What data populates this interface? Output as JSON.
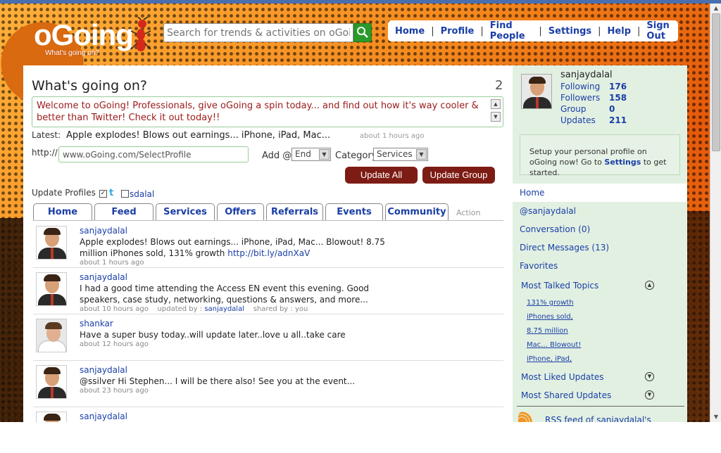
{
  "header": {
    "logo_main": "oGoing",
    "logo_tagline": "What's going on?",
    "search_placeholder": "Search for trends & activities on oGoing",
    "nav": [
      "Home",
      "Profile",
      "Find People",
      "Settings",
      "Help",
      "Sign Out"
    ]
  },
  "composer": {
    "title": "What's going on?",
    "count": "2",
    "status_text": "Welcome to oGoing! Professionals, give oGoing a spin today... and find out how it's way cooler & better than Twitter! Check it out today!!",
    "latest_label": "Latest:",
    "latest_text": "Apple explodes! Blows out earnings... iPhone, iPad, Mac...",
    "latest_ago": "about 1 hours ago",
    "http_label": "http://",
    "url_value": "www.oGoing.com/SelectProfile",
    "add_label": "Add @",
    "add_value": "End",
    "category_label": "Category",
    "category_value": "Services",
    "update_all": "Update All",
    "update_group": "Update Group",
    "update_profiles_label": "Update Profiles",
    "profile_name": "sdalal"
  },
  "tabs": [
    "Home",
    "Feed",
    "Services",
    "Offers",
    "Referrals",
    "Events",
    "Community"
  ],
  "tabs_action": "Action",
  "feed": [
    {
      "user": "sanjaydalal",
      "text": "Apple explodes! Blows out earnings... iPhone, iPad, Mac... Blowout! 8.75 million iPhones sold, 131% growth ",
      "link": "http://bit.ly/adnXaV",
      "ago": "about 1 hours ago"
    },
    {
      "user": "sanjaydalal",
      "text": "I had a good time attending the Access EN event this evening. Good speakers, case study, networking, questions & answers, and more...",
      "ago": "about 10 hours ago",
      "updated_label": "updated by :",
      "updated_by": "sanjaydalal",
      "shared_label": "shared by : you"
    },
    {
      "user": "shankar",
      "text": "Have a super busy today..will update later..love u all..take care",
      "ago": "about 12 hours ago"
    },
    {
      "user": "sanjaydalal",
      "text": "@ssilver Hi Stephen... I will be there also! See you at the event...",
      "ago": "about 23 hours ago"
    },
    {
      "user": "sanjaydalal"
    }
  ],
  "sidebar": {
    "name": "sanjaydalal",
    "stats": [
      {
        "label": "Following",
        "value": "176"
      },
      {
        "label": "Followers",
        "value": "158"
      },
      {
        "label": "Group",
        "value": "0"
      },
      {
        "label": "Updates",
        "value": "211"
      }
    ],
    "setup_prefix": "Setup your personal profile on oGoing now! Go to ",
    "setup_link": "Settings",
    "setup_suffix": " to get started.",
    "links": [
      "Home",
      "@sanjaydalal",
      "Conversation (0)",
      "Direct Messages (13)",
      "Favorites"
    ],
    "most_talked": "Most Talked Topics",
    "topics": [
      "131% growth",
      "iPhones sold,",
      "8.75 million",
      "Mac... Blowout!",
      "iPhone, iPad,"
    ],
    "most_liked": "Most Liked Updates",
    "most_shared": "Most Shared Updates",
    "rss": "RSS feed of sanjaydalal's Updates"
  },
  "colors": {
    "accent": "#1a3ea6",
    "button": "#7d1c14",
    "sidebar_bg": "#e2f0e2"
  }
}
